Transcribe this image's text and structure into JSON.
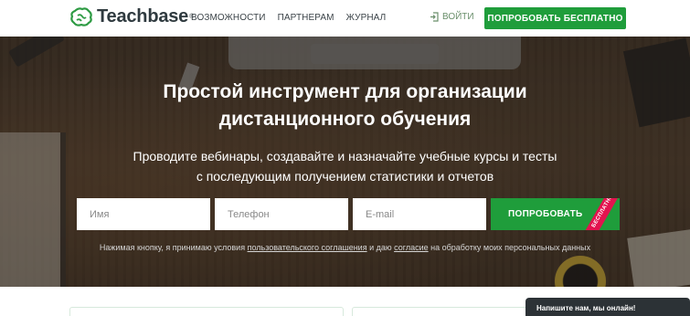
{
  "header": {
    "logo_text": "Teachbase",
    "logo_mark": "®",
    "nav": [
      "ВОЗМОЖНОСТИ",
      "ПАРТНЕРАМ",
      "ЖУРНАЛ"
    ],
    "login_label": "ВОЙТИ",
    "login_icon": "login-arrow-icon",
    "try_label": "ПОПРОБОВАТЬ БЕСПЛАТНО"
  },
  "hero": {
    "title_light": "Простой инструмент ",
    "title_bold_1": "для организации",
    "title_bold_2": "дистанционного обучения",
    "subtitle_1": "Проводите вебинары, создавайте и назначайте учебные курсы и тесты",
    "subtitle_2": "с последующим получением статистики и отчетов"
  },
  "form": {
    "name_placeholder": "Имя",
    "phone_placeholder": "Телефон",
    "email_placeholder": "E-mail",
    "submit_label": "ПОПРОБОВАТЬ",
    "ribbon_label": "БЕСПЛАТНО"
  },
  "consent": {
    "prefix": "Нажимая кнопку, я принимаю условия ",
    "link_1": "пользовательского соглашения",
    "middle": " и даю ",
    "link_2": "согласие",
    "suffix": " на обработку моих персональных данных"
  },
  "chat": {
    "label": "Напишите нам, мы онлайн!"
  },
  "colors": {
    "brand_green": "#1f9d3b",
    "ribbon_red": "#e3134f",
    "chat_dark": "#2c3236"
  }
}
